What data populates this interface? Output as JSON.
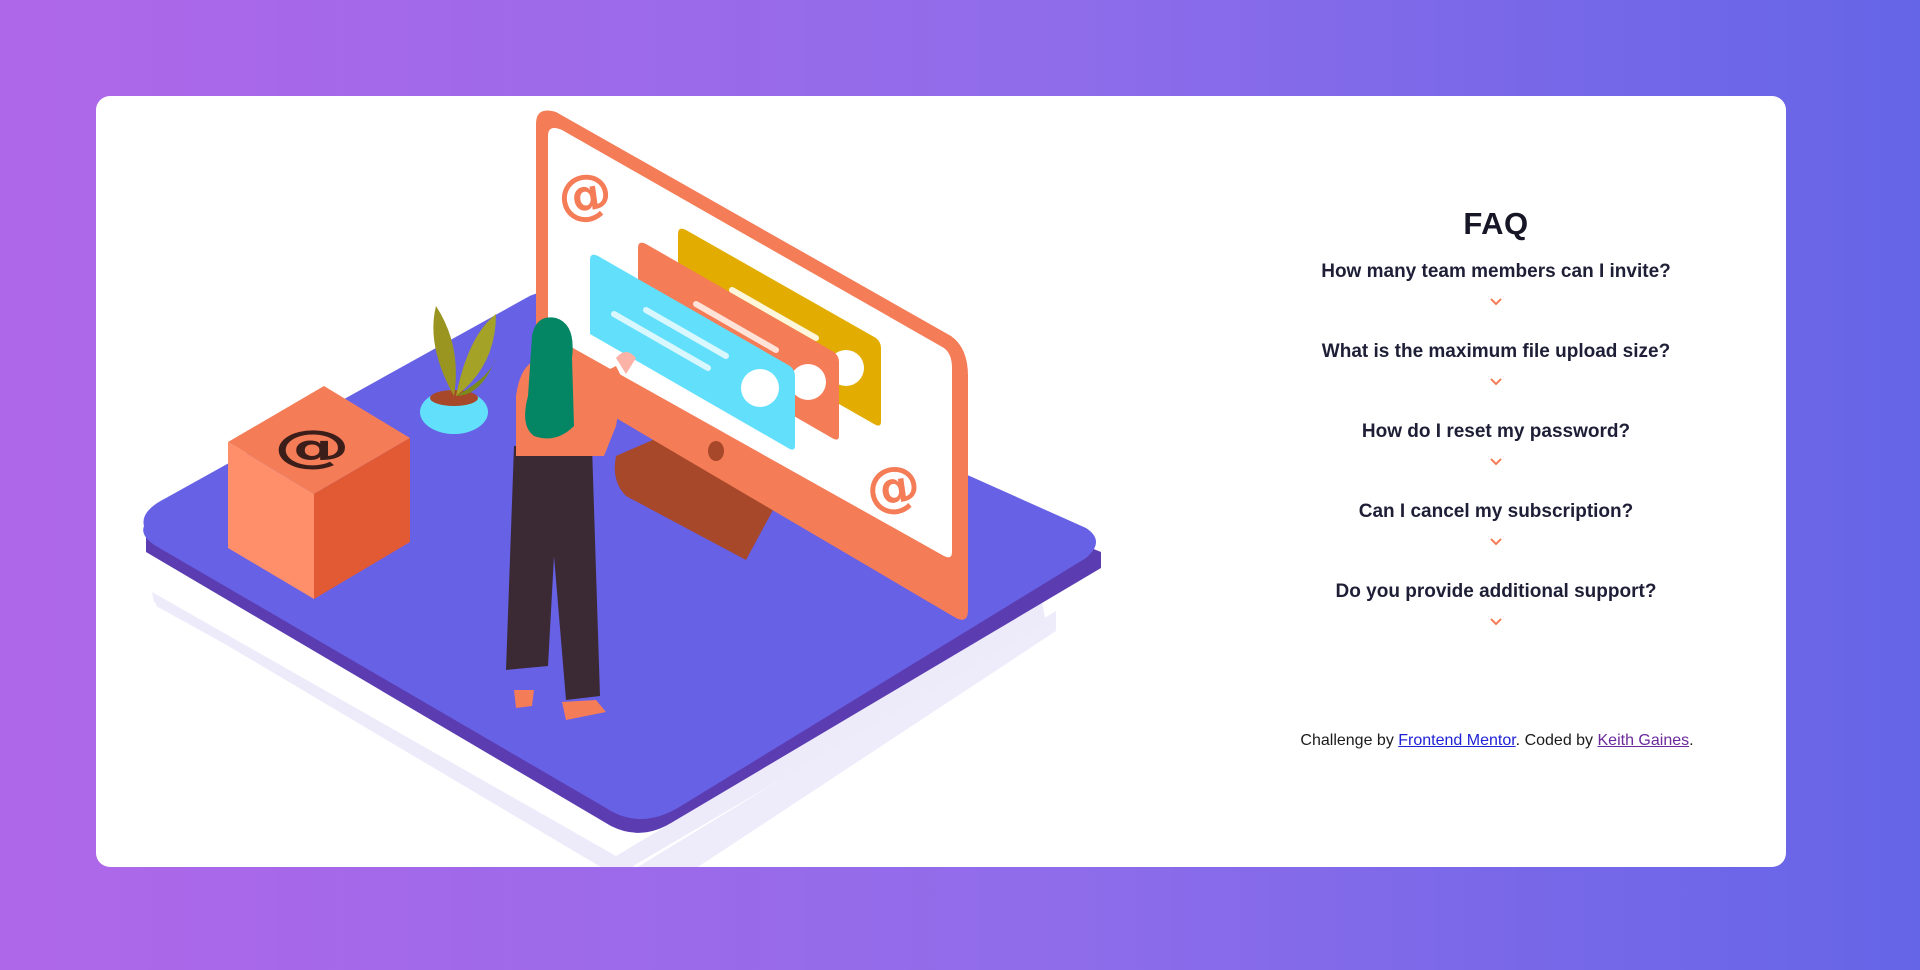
{
  "faq": {
    "title": "FAQ",
    "questions": [
      "How many team members can I invite?",
      "What is the maximum file upload size?",
      "How do I reset my password?",
      "Can I cancel my subscription?",
      "Do you provide additional support?"
    ]
  },
  "attribution": {
    "prefix": "Challenge by ",
    "link1": "Frontend Mentor",
    "middle": ". Coded by ",
    "link2": "Keith Gaines",
    "suffix": "."
  },
  "colors": {
    "background_start": "#af67e9",
    "background_end": "#6565e7",
    "accent": "#f47c57",
    "platform": "#6761e6",
    "heading": "#1e1f36"
  },
  "illustration": {
    "at_symbol": "@",
    "icons": [
      "monitor-icon",
      "email-card-icon",
      "box-icon",
      "plant-icon",
      "person-figure"
    ]
  }
}
